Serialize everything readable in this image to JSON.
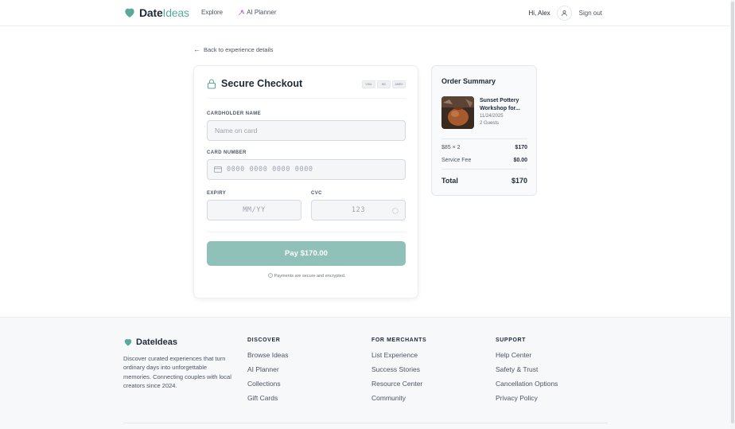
{
  "header": {
    "logo_part1": "Date",
    "logo_part2": "Ideas",
    "nav": {
      "explore": "Explore",
      "ai_planner": "AI Planner"
    },
    "greeting": "Hi, Alex",
    "sign_out": "Sign out"
  },
  "back_link": "Back to experience details",
  "checkout": {
    "title": "Secure Checkout",
    "card_brands": [
      "VISA",
      "MC",
      "AMEX"
    ],
    "cardholder_label": "CARDHOLDER NAME",
    "cardholder_placeholder": "Name on card",
    "cardholder_value": "",
    "card_number_label": "CARD NUMBER",
    "card_number_placeholder": "0000 0000 0000 0000",
    "card_number_value": "",
    "expiry_label": "EXPIRY",
    "expiry_placeholder": "MM/YY",
    "expiry_value": "",
    "cvc_label": "CVC",
    "cvc_placeholder": "123",
    "cvc_value": "",
    "pay_button": "Pay $170.00",
    "secure_note": "Payments are secure and encrypted."
  },
  "order_summary": {
    "title": "Order Summary",
    "experience_name": "Sunset Pottery Workshop for...",
    "date": "11/24/2025",
    "guests": "2 Guests",
    "line_item_label": "$85 × 2",
    "line_item_value": "$170",
    "fee_label": "Service Fee",
    "fee_value": "$0.00",
    "total_label": "Total",
    "total_value": "$170"
  },
  "footer": {
    "brand": "DateIdeas",
    "description": "Discover curated experiences that turn ordinary days into unforgettable memories. Connecting couples with local creators since 2024.",
    "columns": [
      {
        "heading": "DISCOVER",
        "links": [
          "Browse Ideas",
          "AI Planner",
          "Collections",
          "Gift Cards"
        ]
      },
      {
        "heading": "FOR MERCHANTS",
        "links": [
          "List Experience",
          "Success Stories",
          "Resource Center",
          "Community"
        ]
      },
      {
        "heading": "SUPPORT",
        "links": [
          "Help Center",
          "Safety & Trust",
          "Cancellation Options",
          "Privacy Policy"
        ]
      }
    ]
  },
  "colors": {
    "brand": "#5aa99a",
    "pay_button": "#8fc1b8",
    "text": "#1f2937"
  },
  "icons": [
    "heart-logo-icon",
    "sparkle-icon",
    "user-icon",
    "arrow-left-icon",
    "lock-icon",
    "credit-card-icon",
    "help-circle-icon",
    "shield-icon"
  ]
}
